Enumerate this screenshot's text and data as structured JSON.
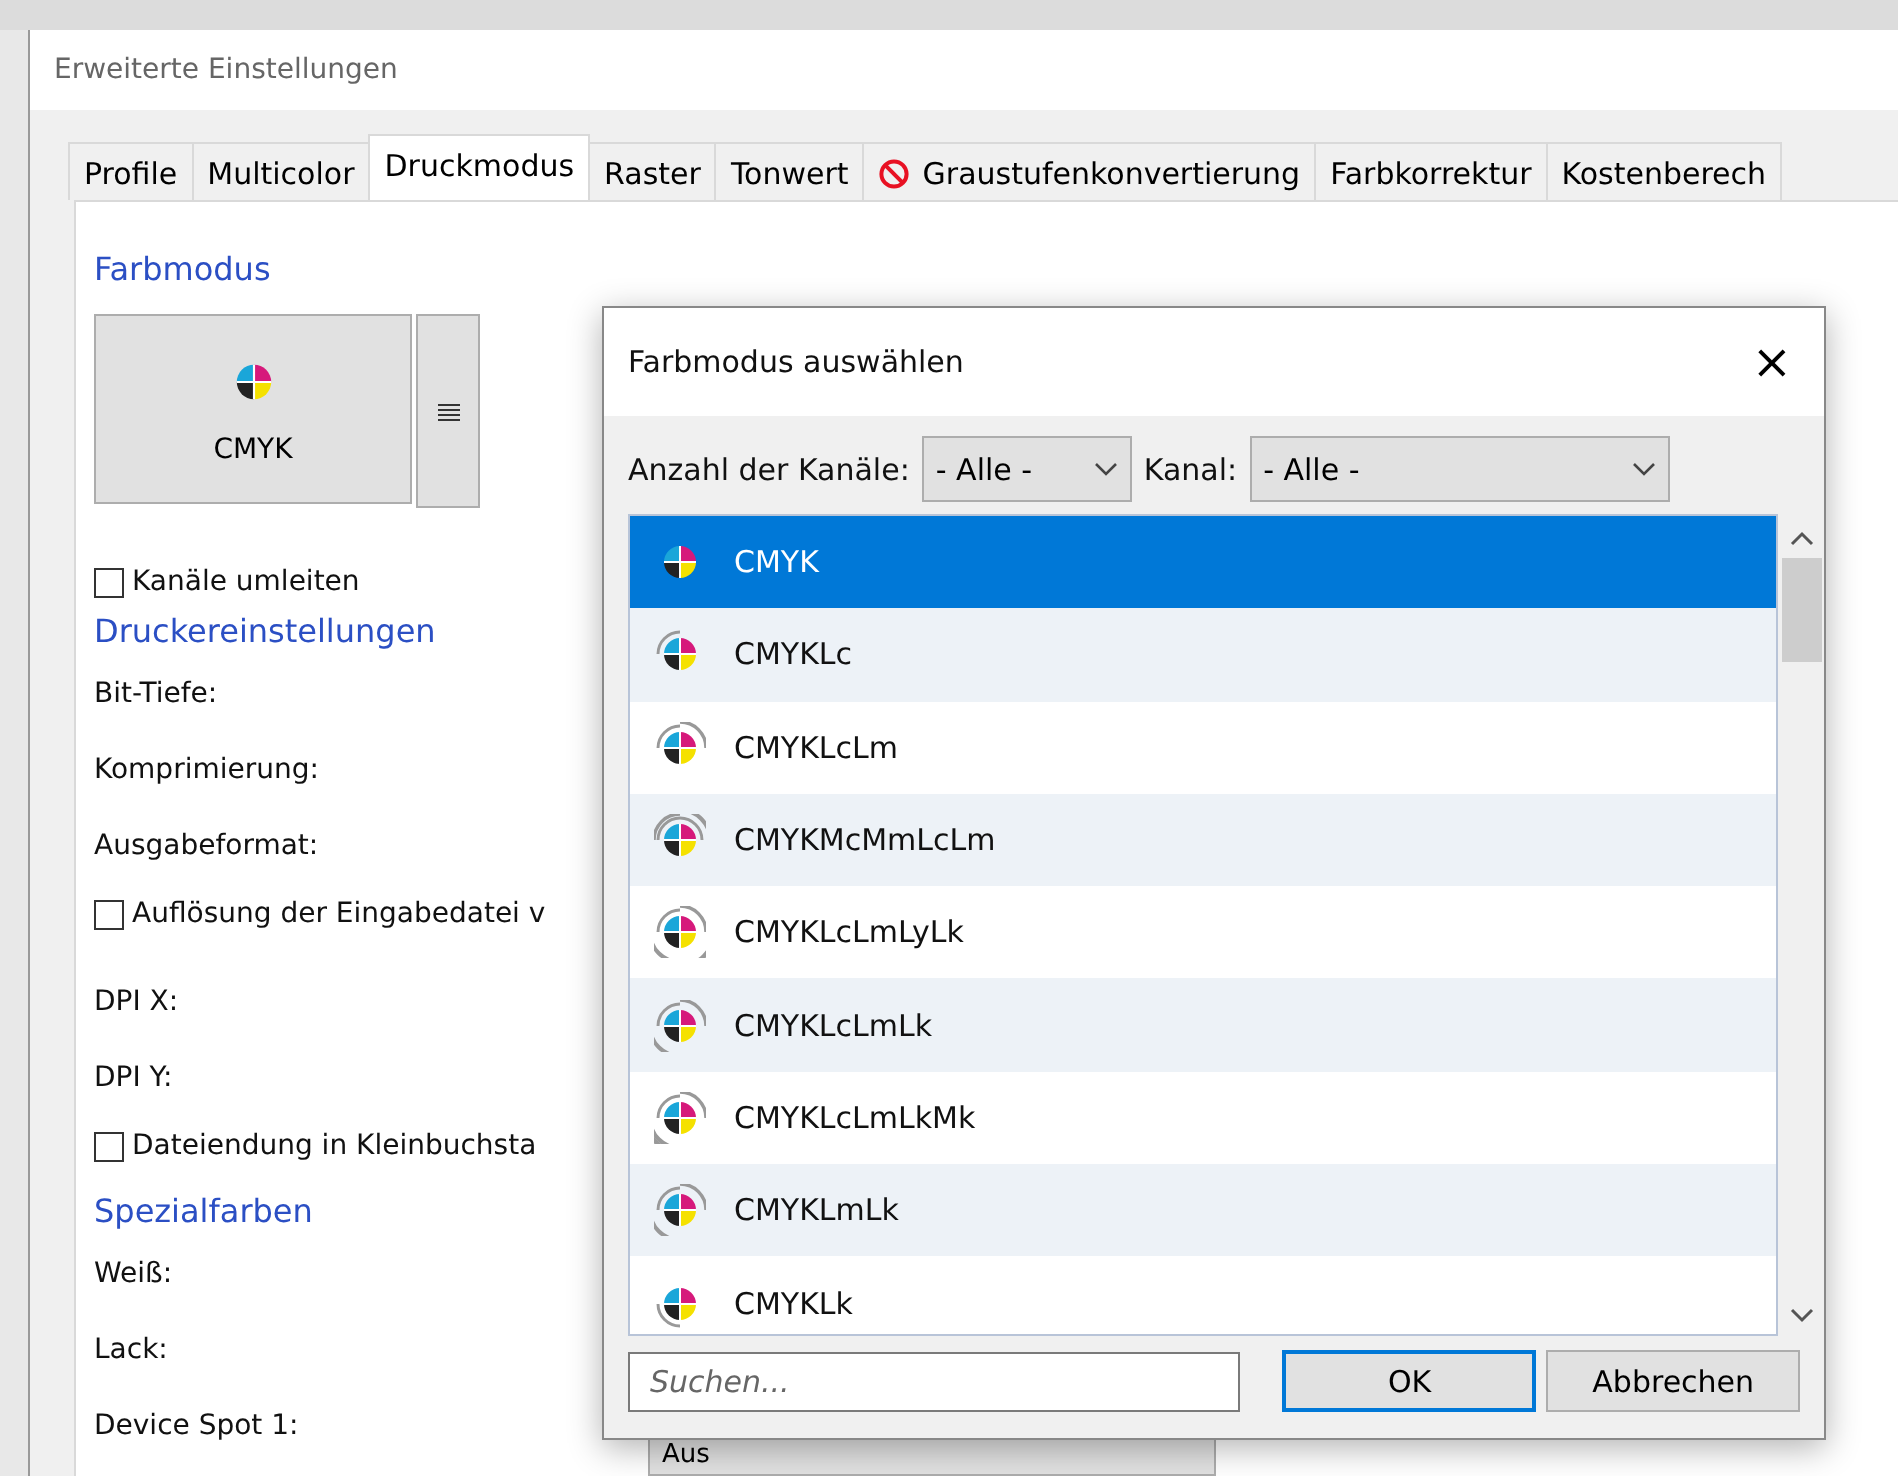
{
  "window": {
    "title": "Erweiterte Einstellungen"
  },
  "tabs": [
    {
      "label": "Profile",
      "selected": false,
      "kind": "plain"
    },
    {
      "label": "Multicolor",
      "selected": false,
      "kind": "plain"
    },
    {
      "label": "Druckmodus",
      "selected": true,
      "kind": "plain"
    },
    {
      "label": "Raster",
      "selected": false,
      "kind": "plain"
    },
    {
      "label": "Tonwert",
      "selected": false,
      "kind": "plain"
    },
    {
      "label": "Graustufenkonvertierung",
      "selected": false,
      "kind": "blocked"
    },
    {
      "label": "Farbkorrektur",
      "selected": false,
      "kind": "plain"
    },
    {
      "label": "Kostenberech",
      "selected": false,
      "kind": "plain"
    }
  ],
  "panel": {
    "items": [
      {
        "kind": "heading",
        "text": "Farbmodus"
      },
      {
        "kind": "mode",
        "text": "CMYK"
      },
      {
        "kind": "checkbox",
        "text": "Kanäle umleiten",
        "checked": false
      },
      {
        "kind": "heading",
        "text": "Druckereinstellungen"
      },
      {
        "kind": "label",
        "text": "Bit-Tiefe:"
      },
      {
        "kind": "label",
        "text": "Komprimierung:"
      },
      {
        "kind": "label",
        "text": "Ausgabeformat:"
      },
      {
        "kind": "checkbox",
        "text": "Auflösung der Eingabedatei v",
        "checked": false
      },
      {
        "kind": "label",
        "text": "DPI X:"
      },
      {
        "kind": "label",
        "text": "DPI Y:"
      },
      {
        "kind": "checkbox",
        "text": "Dateiendung in Kleinbuchsta",
        "checked": false
      },
      {
        "kind": "heading",
        "text": "Spezialfarben"
      },
      {
        "kind": "label",
        "text": "Weiß:"
      },
      {
        "kind": "label",
        "text": "Lack:"
      },
      {
        "kind": "select",
        "text": "Device Spot 1:",
        "value": "Aus"
      }
    ]
  },
  "dialog": {
    "title": "Farbmodus auswählen",
    "close": "×",
    "filters": [
      {
        "label": "Anzahl der Kanäle:",
        "value": "- Alle -"
      },
      {
        "label": "Kanal:",
        "value": "- Alle -"
      }
    ],
    "modes": [
      {
        "name": "CMYK",
        "selected": true
      },
      {
        "name": "CMYKLc",
        "selected": false
      },
      {
        "name": "CMYKLcLm",
        "selected": false
      },
      {
        "name": "CMYKMcMmLcLm",
        "selected": false
      },
      {
        "name": "CMYKLcLmLyLk",
        "selected": false
      },
      {
        "name": "CMYKLcLmLk",
        "selected": false
      },
      {
        "name": "CMYKLcLmLkMk",
        "selected": false
      },
      {
        "name": "CMYKLmLk",
        "selected": false
      },
      {
        "name": "CMYKLk",
        "selected": false
      }
    ],
    "search": {
      "placeholder": "Suchen..."
    },
    "buttons": [
      "OK",
      "Abbrechen"
    ]
  }
}
